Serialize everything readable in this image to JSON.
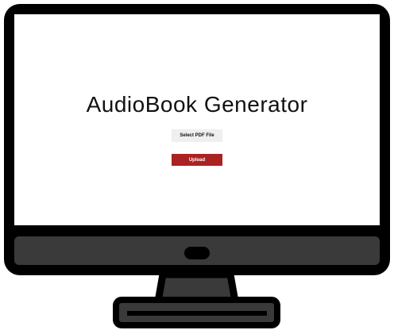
{
  "app": {
    "title": "AudioBook Generator"
  },
  "controls": {
    "select_file_label": "Select PDF File",
    "upload_label": "Upload"
  },
  "colors": {
    "bezel": "#000000",
    "chin": "#3a3a3a",
    "screen_bg": "#ffffff",
    "select_button_bg": "#efefef",
    "upload_button_bg": "#ab2223"
  },
  "icons": {
    "frame": "desktop-monitor-icon"
  }
}
